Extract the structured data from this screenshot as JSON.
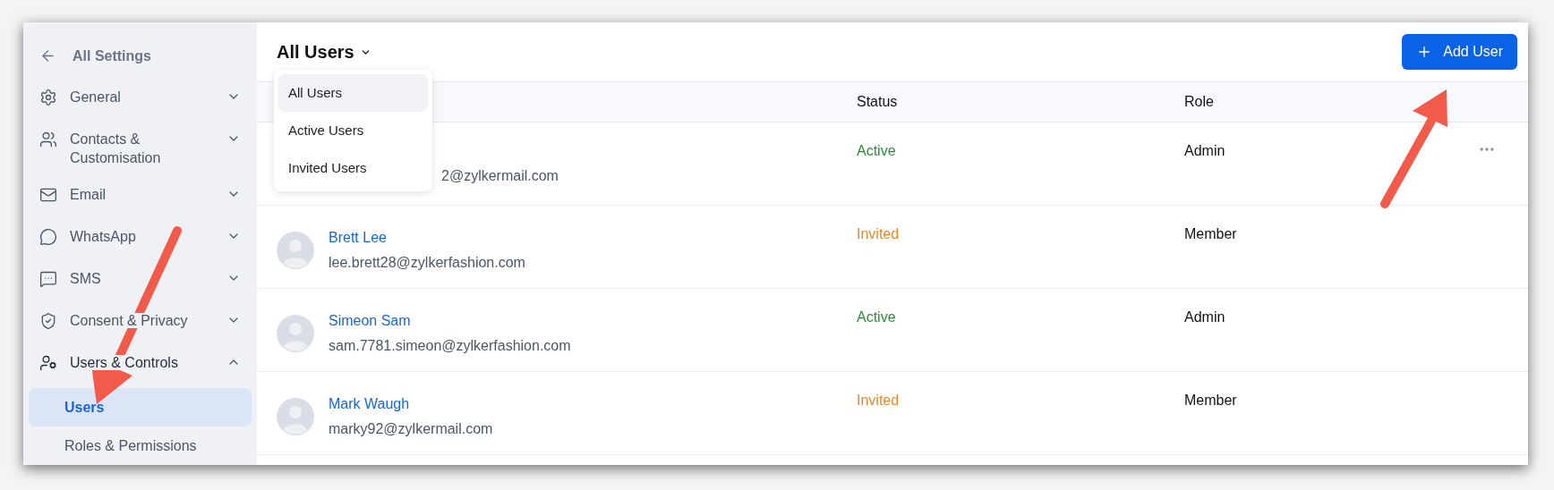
{
  "sidebar": {
    "back": {
      "label": "All Settings"
    },
    "items": [
      {
        "label": "General",
        "expanded": false
      },
      {
        "label": "Contacts & Customisation",
        "expanded": false
      },
      {
        "label": "Email",
        "expanded": false
      },
      {
        "label": "WhatsApp",
        "expanded": false
      },
      {
        "label": "SMS",
        "expanded": false
      },
      {
        "label": "Consent & Privacy",
        "expanded": false
      },
      {
        "label": "Users & Controls",
        "expanded": true,
        "children": [
          {
            "label": "Users",
            "selected": true
          },
          {
            "label": "Roles & Permissions",
            "selected": false
          }
        ]
      }
    ]
  },
  "header": {
    "title": "All Users",
    "button": "Add User"
  },
  "filter_menu": {
    "options": [
      {
        "label": "All Users",
        "selected": true
      },
      {
        "label": "Active Users",
        "selected": false
      },
      {
        "label": "Invited Users",
        "selected": false
      }
    ]
  },
  "table": {
    "columns": [
      "Status",
      "Role"
    ],
    "rows": [
      {
        "email": "2@zylkermail.com",
        "status": "Active",
        "kind": "active",
        "role": "Admin",
        "more_menu": true
      },
      {
        "name": "Brett Lee",
        "email": "lee.brett28@zylkerfashion.com",
        "status": "Invited",
        "kind": "invited",
        "role": "Member",
        "more_menu": false
      },
      {
        "name": "Simeon Sam",
        "email": "sam.7781.simeon@zylkerfashion.com",
        "status": "Active",
        "kind": "active",
        "role": "Admin",
        "more_menu": false
      },
      {
        "name": "Mark Waugh",
        "email": "marky92@zylkermail.com",
        "status": "Invited",
        "kind": "invited",
        "role": "Member",
        "more_menu": false
      }
    ]
  }
}
